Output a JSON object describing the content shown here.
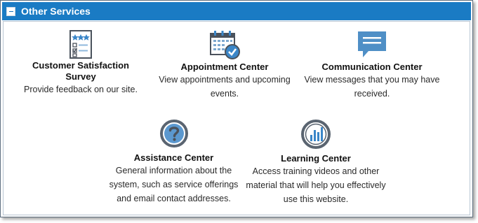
{
  "panel": {
    "title": "Other Services",
    "collapse_icon": "minus-square-icon"
  },
  "services": [
    {
      "id": "survey",
      "name": "Customer Satisfaction Survey",
      "description": "Provide feedback on our site.",
      "icon": "survey-checklist-icon"
    },
    {
      "id": "appointment",
      "name": "Appointment Center",
      "description": "View appointments and upcoming events.",
      "icon": "calendar-check-icon"
    },
    {
      "id": "communication",
      "name": "Communication Center",
      "description": "View messages that you may have received.",
      "icon": "message-bubble-icon"
    },
    {
      "id": "assistance",
      "name": "Assistance Center",
      "description": "General information about the system, such as service offerings and email contact addresses.",
      "icon": "question-mark-icon"
    },
    {
      "id": "learning",
      "name": "Learning Center",
      "description": "Access training videos and other material that will help you effectively use this website.",
      "icon": "bar-chart-circle-icon"
    }
  ],
  "colors": {
    "header_bg": "#1a7bc4",
    "icon_blue": "#3a86c8",
    "icon_gray": "#5a6470"
  }
}
